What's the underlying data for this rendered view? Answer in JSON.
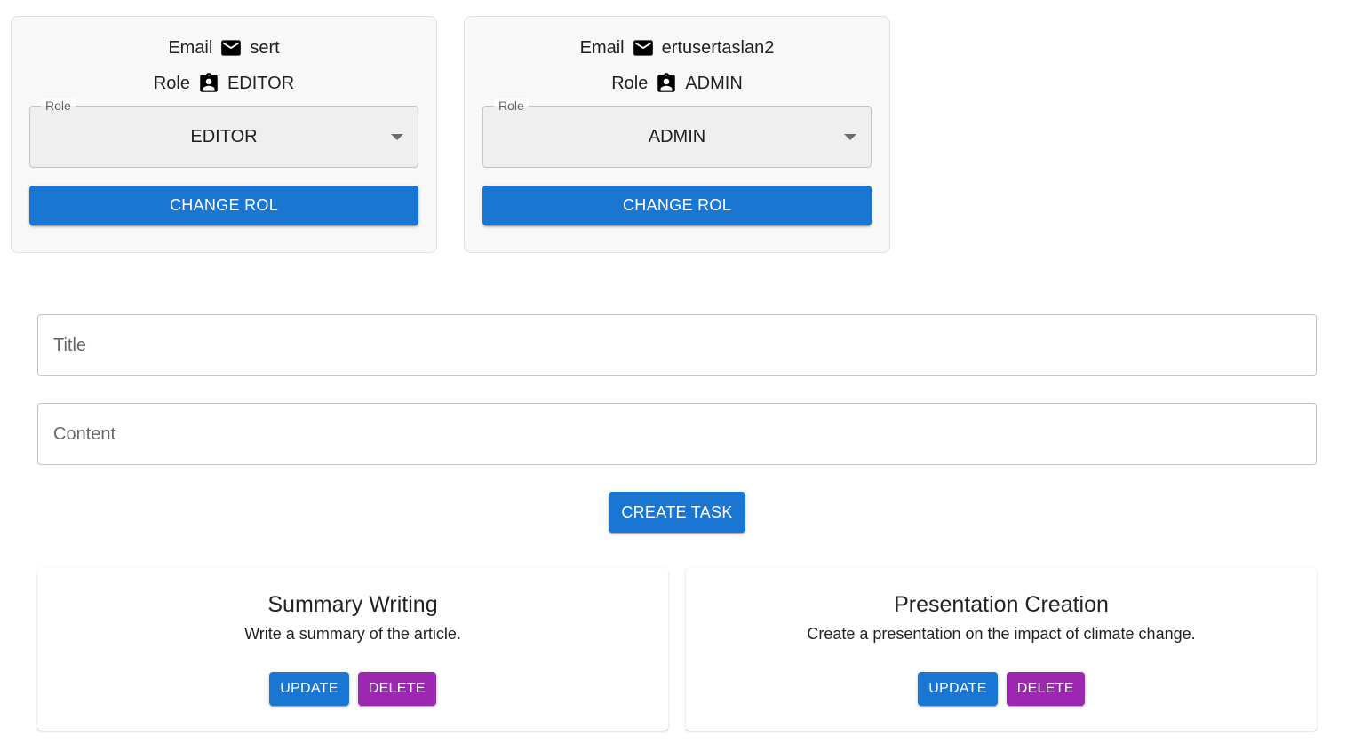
{
  "users": [
    {
      "email_label": "Email",
      "email_icon": "mail-icon",
      "email": "sert",
      "role_label": "Role",
      "role_icon": "badge-icon",
      "role": "EDITOR",
      "select_label": "Role",
      "selected_role": "EDITOR",
      "button_label": "CHANGE ROL"
    },
    {
      "email_label": "Email",
      "email_icon": "mail-icon",
      "email": "ertusertaslan2",
      "role_label": "Role",
      "role_icon": "badge-icon",
      "role": "ADMIN",
      "select_label": "Role",
      "selected_role": "ADMIN",
      "button_label": "CHANGE ROL"
    }
  ],
  "form": {
    "title_placeholder": "Title",
    "title_value": "",
    "content_placeholder": "Content",
    "content_value": "",
    "create_label": "CREATE TASK"
  },
  "tasks": [
    {
      "title": "Summary Writing",
      "content": "Write a summary of the article.",
      "update_label": "UPDATE",
      "delete_label": "DELETE"
    },
    {
      "title": "Presentation Creation",
      "content": "Create a presentation on the impact of climate change.",
      "update_label": "UPDATE",
      "delete_label": "DELETE"
    }
  ],
  "colors": {
    "primary": "#1976d2",
    "secondary": "#9c27b0",
    "card_bg": "#f8f8f8"
  }
}
